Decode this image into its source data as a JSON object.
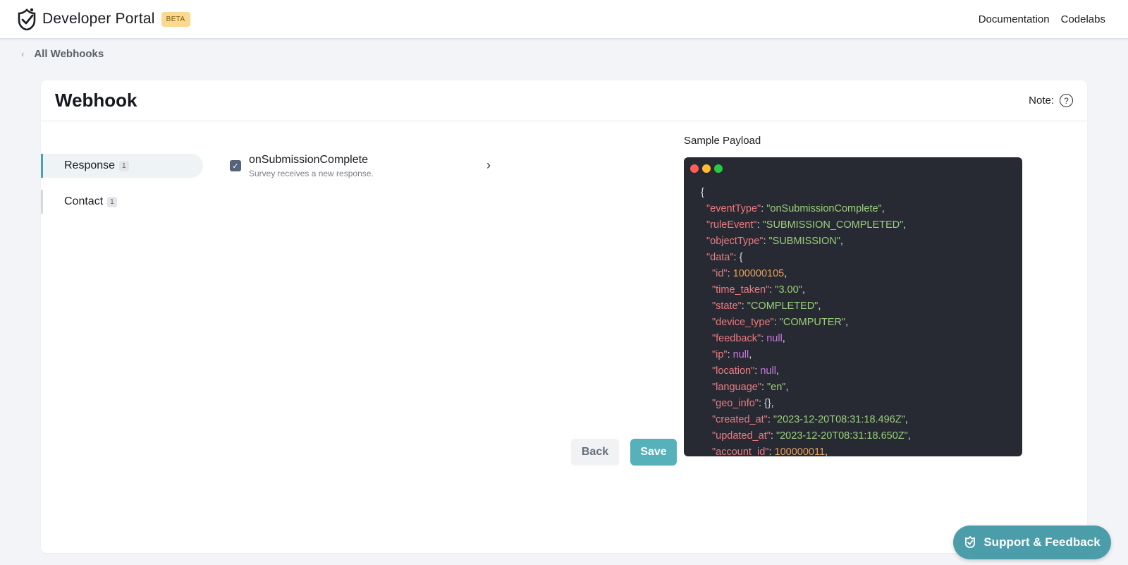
{
  "header": {
    "brand": "Developer Portal",
    "beta": "BETA",
    "nav": [
      "Documentation",
      "Codelabs"
    ]
  },
  "breadcrumb": {
    "label": "All Webhooks"
  },
  "card": {
    "title": "Webhook",
    "note": "Note:",
    "help": "?"
  },
  "tabs": [
    {
      "label": "Response",
      "count": "1",
      "active": true
    },
    {
      "label": "Contact",
      "count": "1",
      "active": false
    }
  ],
  "event": {
    "name": "onSubmissionComplete",
    "description": "Survey receives a new response.",
    "checked": true
  },
  "buttons": {
    "back": "Back",
    "save": "Save"
  },
  "payload": {
    "label": "Sample Payload",
    "lines": [
      [
        {
          "t": "{",
          "c": "p"
        }
      ],
      [
        {
          "t": "\"eventType\"",
          "c": "k"
        },
        {
          "t": ": ",
          "c": "p"
        },
        {
          "t": "\"onSubmissionComplete\"",
          "c": "s"
        },
        {
          "t": ",",
          "c": "p"
        }
      ],
      [
        {
          "t": "\"ruleEvent\"",
          "c": "k"
        },
        {
          "t": ": ",
          "c": "p"
        },
        {
          "t": "\"SUBMISSION_COMPLETED\"",
          "c": "s"
        },
        {
          "t": ",",
          "c": "p"
        }
      ],
      [
        {
          "t": "\"objectType\"",
          "c": "k"
        },
        {
          "t": ": ",
          "c": "p"
        },
        {
          "t": "\"SUBMISSION\"",
          "c": "s"
        },
        {
          "t": ",",
          "c": "p"
        }
      ],
      [
        {
          "t": "\"data\"",
          "c": "k"
        },
        {
          "t": ": {",
          "c": "p"
        }
      ],
      [
        {
          "t": "\"id\"",
          "c": "k"
        },
        {
          "t": ": ",
          "c": "p"
        },
        {
          "t": "100000105",
          "c": "n"
        },
        {
          "t": ",",
          "c": "p"
        }
      ],
      [
        {
          "t": "\"time_taken\"",
          "c": "k"
        },
        {
          "t": ": ",
          "c": "p"
        },
        {
          "t": "\"3.00\"",
          "c": "s"
        },
        {
          "t": ",",
          "c": "p"
        }
      ],
      [
        {
          "t": "\"state\"",
          "c": "k"
        },
        {
          "t": ": ",
          "c": "p"
        },
        {
          "t": "\"COMPLETED\"",
          "c": "s"
        },
        {
          "t": ",",
          "c": "p"
        }
      ],
      [
        {
          "t": "\"device_type\"",
          "c": "k"
        },
        {
          "t": ": ",
          "c": "p"
        },
        {
          "t": "\"COMPUTER\"",
          "c": "s"
        },
        {
          "t": ",",
          "c": "p"
        }
      ],
      [
        {
          "t": "\"feedback\"",
          "c": "k"
        },
        {
          "t": ": ",
          "c": "p"
        },
        {
          "t": "null",
          "c": "nl"
        },
        {
          "t": ",",
          "c": "p"
        }
      ],
      [
        {
          "t": "\"ip\"",
          "c": "k"
        },
        {
          "t": ": ",
          "c": "p"
        },
        {
          "t": "null",
          "c": "nl"
        },
        {
          "t": ",",
          "c": "p"
        }
      ],
      [
        {
          "t": "\"location\"",
          "c": "k"
        },
        {
          "t": ": ",
          "c": "p"
        },
        {
          "t": "null",
          "c": "nl"
        },
        {
          "t": ",",
          "c": "p"
        }
      ],
      [
        {
          "t": "\"language\"",
          "c": "k"
        },
        {
          "t": ": ",
          "c": "p"
        },
        {
          "t": "\"en\"",
          "c": "s"
        },
        {
          "t": ",",
          "c": "p"
        }
      ],
      [
        {
          "t": "\"geo_info\"",
          "c": "k"
        },
        {
          "t": ": {},",
          "c": "p"
        }
      ],
      [
        {
          "t": "\"created_at\"",
          "c": "k"
        },
        {
          "t": ": ",
          "c": "p"
        },
        {
          "t": "\"2023-12-20T08:31:18.496Z\"",
          "c": "s"
        },
        {
          "t": ",",
          "c": "p"
        }
      ],
      [
        {
          "t": "\"updated_at\"",
          "c": "k"
        },
        {
          "t": ": ",
          "c": "p"
        },
        {
          "t": "\"2023-12-20T08:31:18.650Z\"",
          "c": "s"
        },
        {
          "t": ",",
          "c": "p"
        }
      ],
      [
        {
          "t": "\"account_id\"",
          "c": "k"
        },
        {
          "t": ": ",
          "c": "p"
        },
        {
          "t": "100000011",
          "c": "n"
        },
        {
          "t": ",",
          "c": "p"
        }
      ]
    ],
    "indent": [
      1,
      2,
      2,
      2,
      2,
      3,
      3,
      3,
      3,
      3,
      3,
      3,
      3,
      3,
      3,
      3,
      3
    ]
  },
  "support": {
    "label": "Support & Feedback"
  },
  "colors": {
    "accent": "#56b1ba",
    "support": "#4c9daa",
    "beta": "#fbd98f",
    "code_bg": "#272a33",
    "dot_red": "#ff5f57",
    "dot_yellow": "#febc2e",
    "dot_green": "#28c840"
  }
}
